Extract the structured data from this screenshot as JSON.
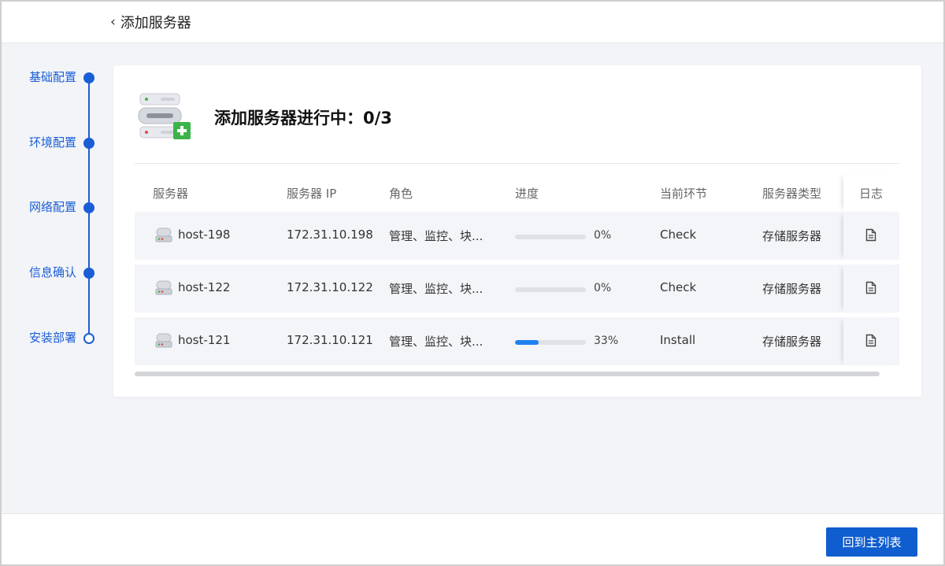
{
  "header": {
    "back_icon": "‹",
    "title": "添加服务器"
  },
  "steps": [
    {
      "label": "基础配置",
      "state": "done"
    },
    {
      "label": "环境配置",
      "state": "done"
    },
    {
      "label": "网络配置",
      "state": "done"
    },
    {
      "label": "信息确认",
      "state": "done"
    },
    {
      "label": "安装部署",
      "state": "current"
    }
  ],
  "card": {
    "title": "添加服务器进行中：0/3"
  },
  "table": {
    "columns": [
      "服务器",
      "服务器 IP",
      "角色",
      "进度",
      "当前环节",
      "服务器类型",
      "日志"
    ],
    "rows": [
      {
        "host": "host-198",
        "ip": "172.31.10.198",
        "role": "管理、监控、块...",
        "progress": 0,
        "pct": "0%",
        "stage": "Check",
        "type": "存储服务器"
      },
      {
        "host": "host-122",
        "ip": "172.31.10.122",
        "role": "管理、监控、块...",
        "progress": 0,
        "pct": "0%",
        "stage": "Check",
        "type": "存储服务器"
      },
      {
        "host": "host-121",
        "ip": "172.31.10.121",
        "role": "管理、监控、块...",
        "progress": 33,
        "pct": "33%",
        "stage": "Install",
        "type": "存储服务器"
      }
    ]
  },
  "footer": {
    "primary_label": "回到主列表"
  },
  "colors": {
    "accent": "#1a5ed6",
    "progress": "#1f80f0",
    "button": "#0f5dcf",
    "success": "#3cb44a"
  }
}
